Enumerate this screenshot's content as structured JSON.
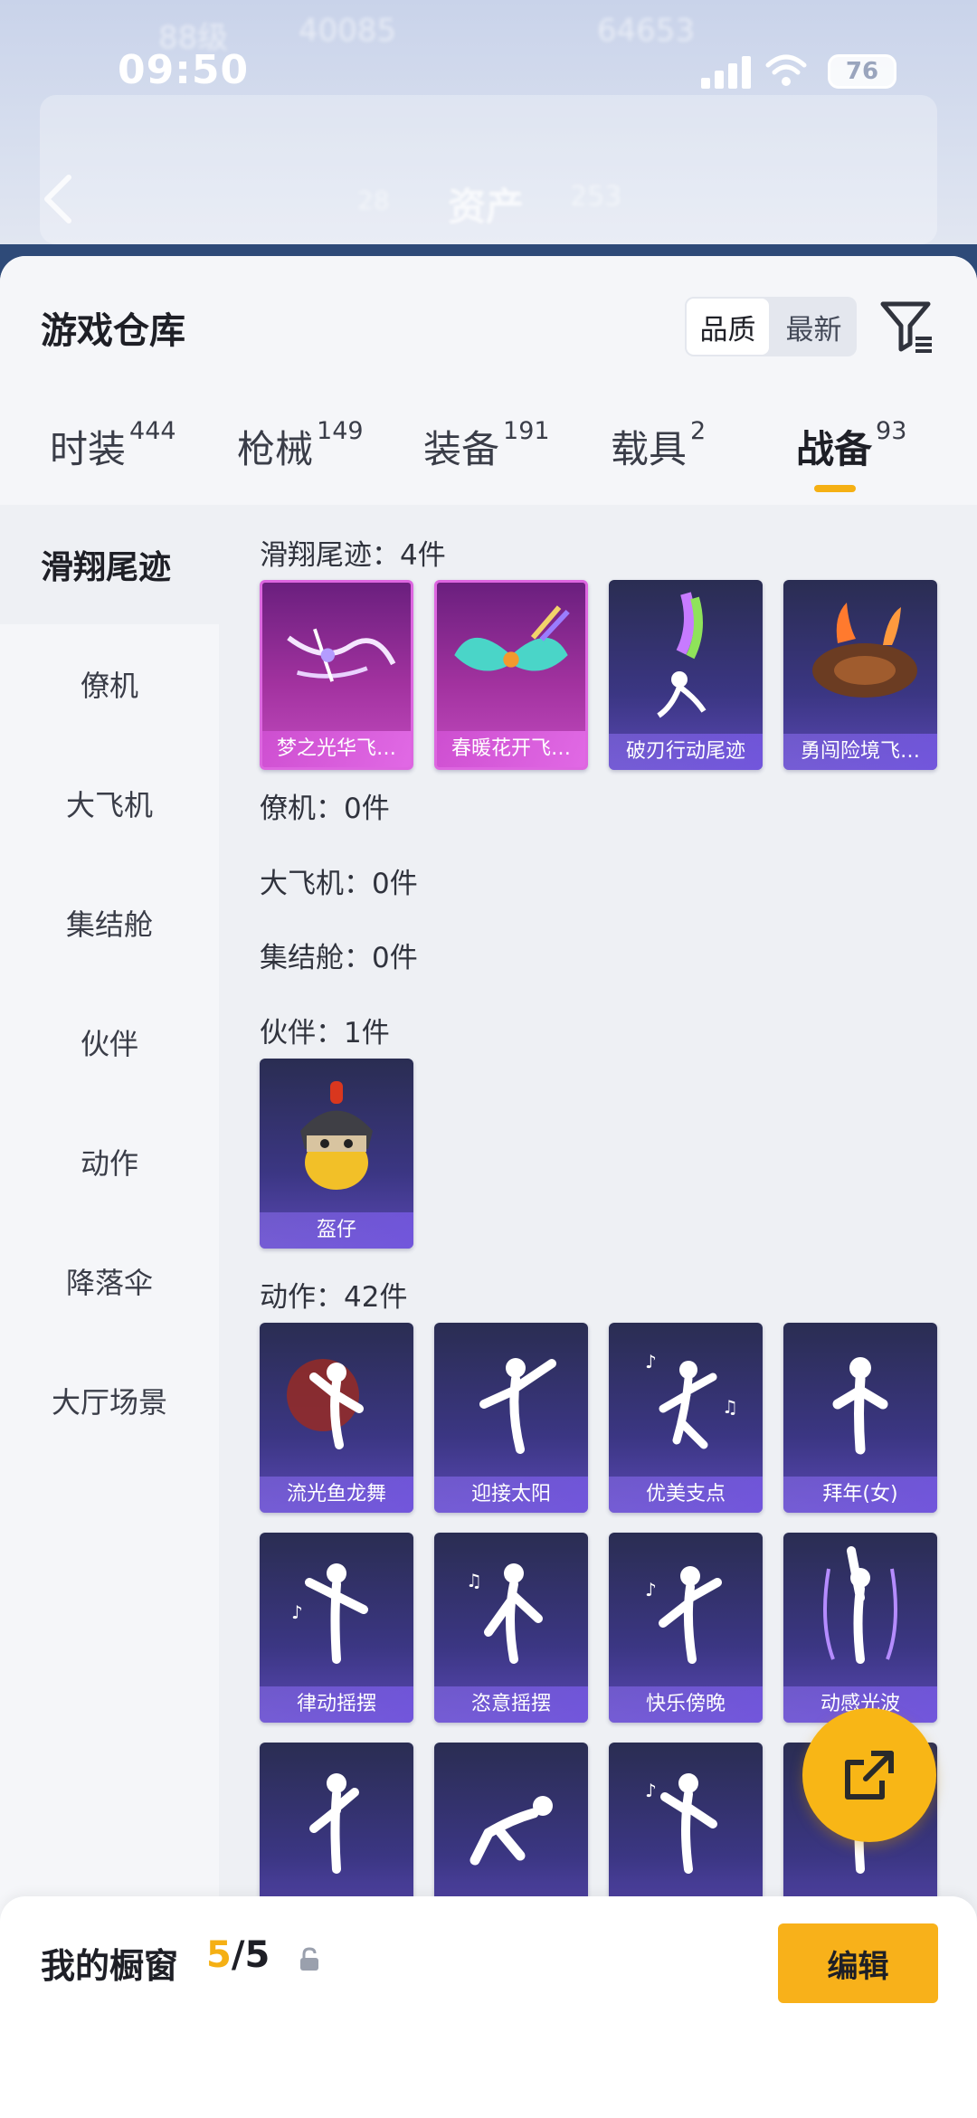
{
  "status_bar": {
    "time": "09:50",
    "battery": "76"
  },
  "background": {
    "ghost_level": "88级",
    "ghost_a": "40085",
    "ghost_b": "64653",
    "ghost_title": "资产",
    "ghost_c": "253",
    "ghost_d": "28"
  },
  "sheet": {
    "title": "游戏仓库"
  },
  "sort": {
    "quality": "品质",
    "newest": "最新"
  },
  "tabs": [
    {
      "label": "时装",
      "count": "444"
    },
    {
      "label": "枪械",
      "count": "149"
    },
    {
      "label": "装备",
      "count": "191"
    },
    {
      "label": "载具",
      "count": "2"
    },
    {
      "label": "战备",
      "count": "93"
    }
  ],
  "sidebar": [
    {
      "label": "滑翔尾迹"
    },
    {
      "label": "僚机"
    },
    {
      "label": "大飞机"
    },
    {
      "label": "集结舱"
    },
    {
      "label": "伙伴"
    },
    {
      "label": "动作"
    },
    {
      "label": "降落伞"
    },
    {
      "label": "大厅场景"
    }
  ],
  "sections": {
    "trail": {
      "label": "滑翔尾迹：4件",
      "items": [
        "梦之光华飞…",
        "春暖花开飞…",
        "破刃行动尾迹",
        "勇闯险境飞…"
      ]
    },
    "wingman": {
      "label": "僚机：0件"
    },
    "plane": {
      "label": "大飞机：0件"
    },
    "pod": {
      "label": "集结舱：0件"
    },
    "companion": {
      "label": "伙伴：1件",
      "items": [
        "盔仔"
      ]
    },
    "emote": {
      "label": "动作：42件",
      "items": [
        "流光鱼龙舞",
        "迎接太阳",
        "优美支点",
        "拜年(女)",
        "律动摇摆",
        "恣意摇摆",
        "快乐傍晚",
        "动感光波",
        "",
        "",
        "",
        ""
      ]
    }
  },
  "bottom": {
    "title": "我的橱窗",
    "count_current": "5",
    "count_sep": "/5",
    "edit": "编辑"
  },
  "colors": {
    "accent": "#f5b014",
    "epic_purple": "#c24bc0",
    "rare_blue": "#3b3683"
  }
}
